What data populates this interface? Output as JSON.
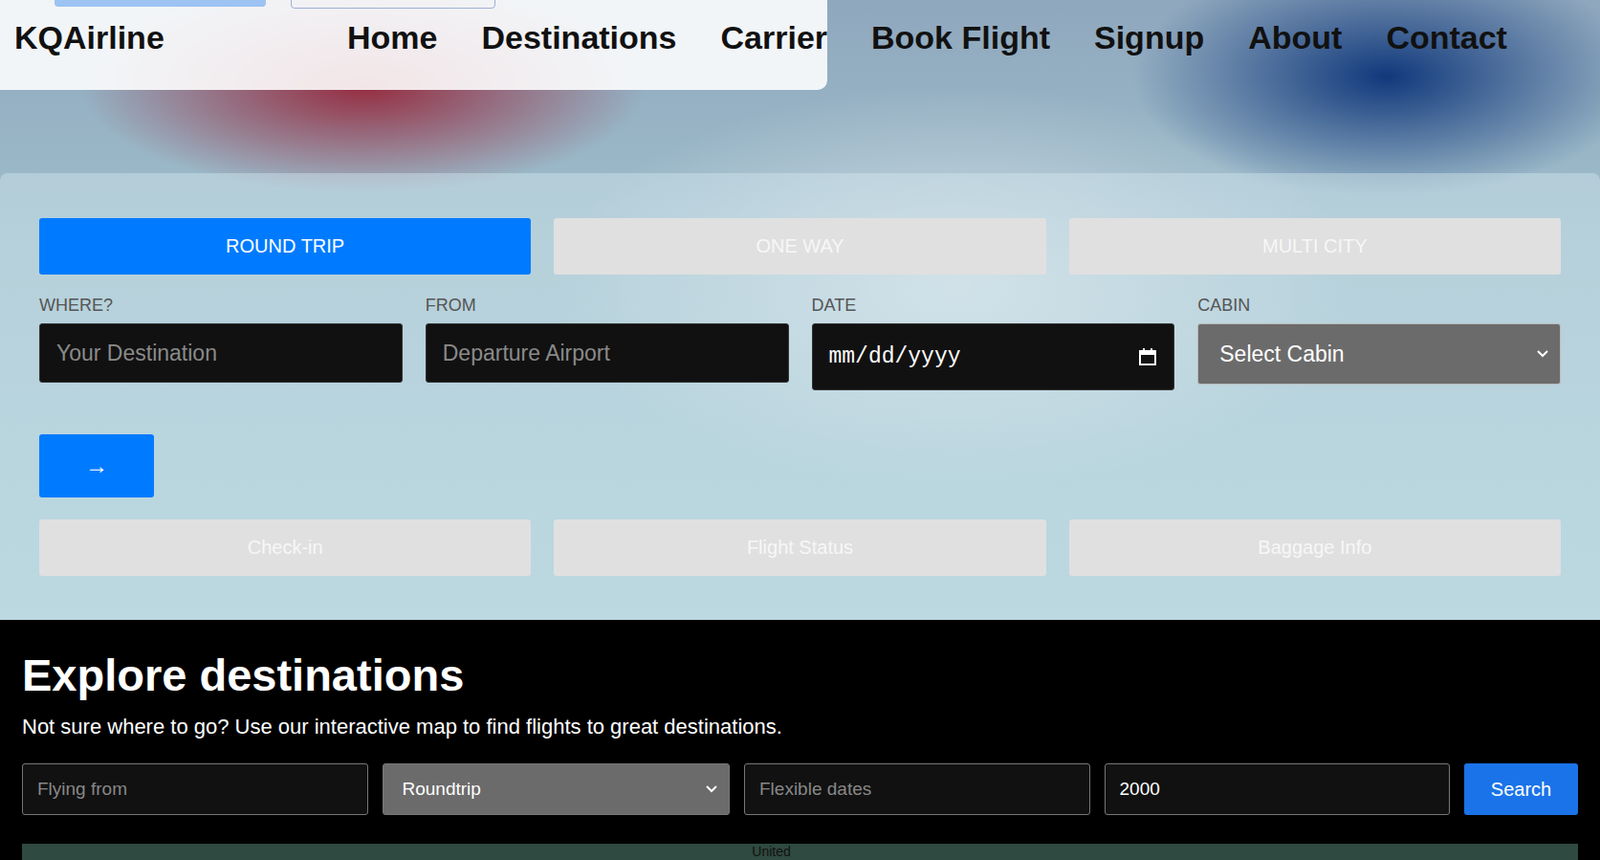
{
  "brand": "KQAirline",
  "nav": [
    "Home",
    "Destinations",
    "Carrier",
    "Book Flight",
    "Signup",
    "About",
    "Contact"
  ],
  "trip_tabs": [
    {
      "label": "ROUND TRIP",
      "selected": true
    },
    {
      "label": "ONE WAY",
      "selected": false
    },
    {
      "label": "MULTI CITY",
      "selected": false
    }
  ],
  "fields": [
    {
      "label": "WHERE?",
      "kind": "text",
      "placeholder": "Your Destination"
    },
    {
      "label": "FROM",
      "kind": "text",
      "placeholder": "Departure Airport"
    },
    {
      "label": "DATE",
      "kind": "date",
      "placeholder": "mm/dd/yyyy"
    },
    {
      "label": "CABIN",
      "kind": "select",
      "placeholder": "Select Cabin"
    }
  ],
  "submit_button": "→",
  "quick_links": [
    "Check-in",
    "Flight Status",
    "Baggage Info"
  ],
  "explore": {
    "title": "Explore destinations",
    "subtitle": "Not sure where to go? Use our interactive map to find flights to great destinations.",
    "fields": [
      {
        "kind": "text",
        "placeholder": "Flying from",
        "value": ""
      },
      {
        "kind": "select",
        "placeholder": "",
        "value": "Roundtrip"
      },
      {
        "kind": "text",
        "placeholder": "Flexible dates",
        "value": ""
      },
      {
        "kind": "text",
        "placeholder": "",
        "value": "2000"
      }
    ],
    "button": "Search"
  },
  "map": {
    "label": "United"
  }
}
